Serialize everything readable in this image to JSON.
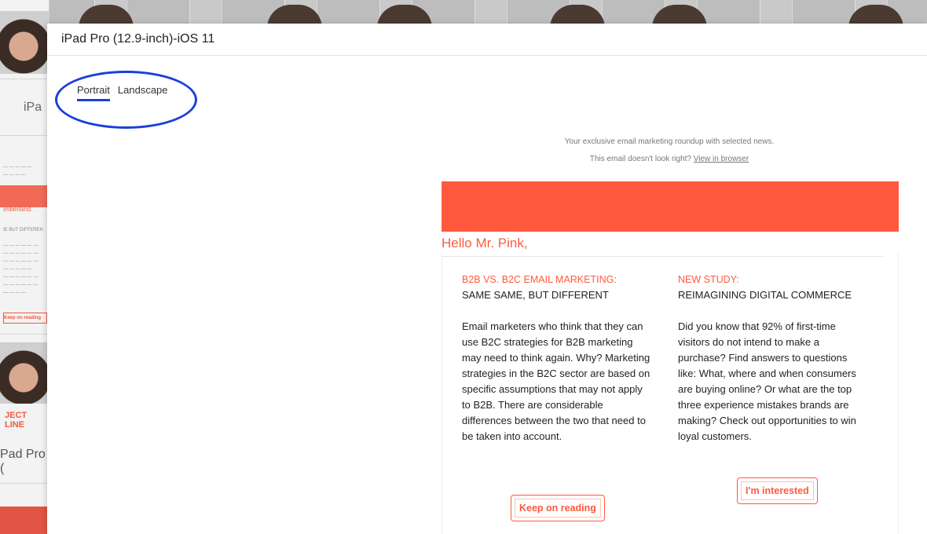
{
  "background": {
    "ghost_texts": [
      "iPa",
      "imberland.",
      "IE BUT DIFFEREN",
      "Keep on reading",
      "JECT LINE",
      "Pad Pro ("
    ]
  },
  "modal": {
    "title": "iPad Pro (12.9-inch)-iOS 11",
    "tabs": [
      {
        "label": "Portrait",
        "active": true
      },
      {
        "label": "Landscape",
        "active": false
      }
    ],
    "highlight_color": "#1a3fd9"
  },
  "email": {
    "preheader": "Your exclusive email marketing roundup with selected news.",
    "view_prompt": "This email doesn't look right?",
    "view_link": "View in browser",
    "accent_color": "#ff5a3e",
    "greeting": "Hello Mr. Pink,",
    "columns": [
      {
        "kicker": "B2B VS. B2C EMAIL MARKETING:",
        "headline": "SAME SAME, BUT DIFFERENT",
        "body": "Email marketers who think that they can use B2C strategies for B2B marketing may need to think again. Why? Marketing strategies in the B2C sector are based on specific assumptions that may not apply to B2B. There are considerable differences between the two that need to be taken into account.",
        "cta": "Keep on reading"
      },
      {
        "kicker": "NEW STUDY:",
        "headline": "REIMAGINING DIGITAL COMMERCE",
        "body": "Did you know that 92% of first-time visitors do not intend to make a purchase? Find answers to questions like: What, where and when consumers are buying online? Or what are the top three experience mistakes brands are making? Check out opportunities to win loyal customers.",
        "cta": "I'm interested"
      }
    ]
  }
}
